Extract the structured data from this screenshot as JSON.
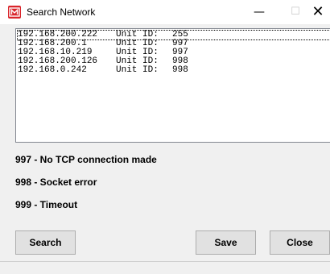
{
  "window": {
    "title": "Search Network",
    "minimize_glyph": "—",
    "maximize_glyph": "☐",
    "close_glyph": "✕",
    "icon": "app-m-icon",
    "accent_color": "#d9242a"
  },
  "results": {
    "rows": [
      {
        "ip": "192.168.200.222",
        "uid_label": "Unit ID:",
        "uid": "255"
      },
      {
        "ip": "192.168.200.1",
        "uid_label": "Unit ID:",
        "uid": "997"
      },
      {
        "ip": "192.168.10.219",
        "uid_label": "Unit ID:",
        "uid": "997"
      },
      {
        "ip": "192.168.200.126",
        "uid_label": "Unit ID:",
        "uid": "998"
      },
      {
        "ip": "192.168.0.242",
        "uid_label": "Unit ID:",
        "uid": "998"
      }
    ]
  },
  "legend": {
    "code_997": "997 - No TCP connection made",
    "code_998": "998 - Socket error",
    "code_999": "999 - Timeout"
  },
  "buttons": {
    "search": "Search",
    "save": "Save",
    "close": "Close"
  }
}
